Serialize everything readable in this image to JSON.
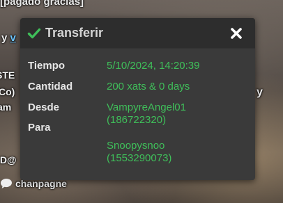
{
  "background": {
    "top_text": "[pagado gracias]",
    "y_prefix": "y ",
    "y_link": "v",
    "side_text_1": "STE",
    "side_text_2": "Co)",
    "side_text_3": "am",
    "side_text_4": "y",
    "side_text_5": "ID@",
    "username": "chanpagne"
  },
  "dialog": {
    "title": "Transferir",
    "rows": [
      {
        "label": "Tiempo",
        "value": "5/10/2024, 14:20:39"
      },
      {
        "label": "Cantidad",
        "value": "200 xats & 0 days"
      },
      {
        "label": "Desde",
        "value_line1": "VampyreAngel01",
        "value_line2": "(186722320)"
      },
      {
        "label": "Para",
        "value_line1": "Snoopysnoo",
        "value_line2": "(1553290073)"
      }
    ]
  },
  "colors": {
    "accent_green": "#3fbf5a",
    "header_bg": "#2d2d2d",
    "body_bg": "#3a3a3a"
  },
  "icons": {
    "header": "check-icon",
    "close": "close-icon",
    "chat": "chat-bubble-icon"
  }
}
